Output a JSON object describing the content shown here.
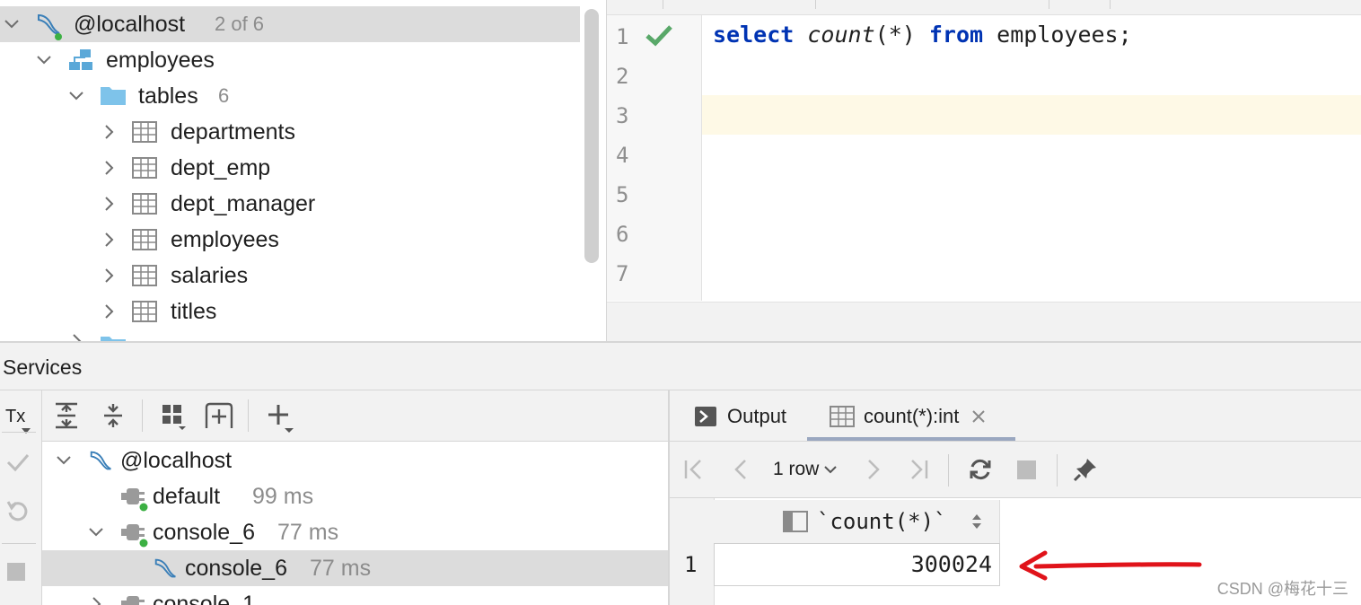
{
  "db_tree": {
    "rows": [
      {
        "label": "@localhost",
        "meta": "2 of 6"
      },
      {
        "label": "employees"
      },
      {
        "label": "tables",
        "meta": "6"
      },
      {
        "label": "departments"
      },
      {
        "label": "dept_emp"
      },
      {
        "label": "dept_manager"
      },
      {
        "label": "employees"
      },
      {
        "label": "salaries"
      },
      {
        "label": "titles"
      }
    ]
  },
  "editor": {
    "line_numbers": [
      "1",
      "2",
      "3",
      "4",
      "5",
      "6",
      "7"
    ],
    "code": {
      "kw_select": "select",
      "fn_count": "count",
      "args": "(*)",
      "kw_from": "from",
      "rest": "employees;"
    }
  },
  "services": {
    "title": "Services",
    "tx_label": "Tx",
    "tree": [
      {
        "label": "@localhost"
      },
      {
        "label": "default",
        "meta": "99 ms"
      },
      {
        "label": "console_6",
        "meta": "77 ms"
      },
      {
        "label": "console_6",
        "meta": "77 ms"
      },
      {
        "label": "console_1"
      }
    ]
  },
  "result": {
    "tabs": {
      "output": "Output",
      "result": "count(*):int"
    },
    "row_selector": "1 row",
    "column_header": "`count(*)`",
    "row_number": "1",
    "cell_value": "300024"
  },
  "watermark": "CSDN @梅花十三",
  "colors": {
    "keyword": "#0033b3",
    "success": "#59a869",
    "arrow": "#e0131a",
    "selection": "#dcdcdc",
    "current_line": "#fef9e6"
  }
}
